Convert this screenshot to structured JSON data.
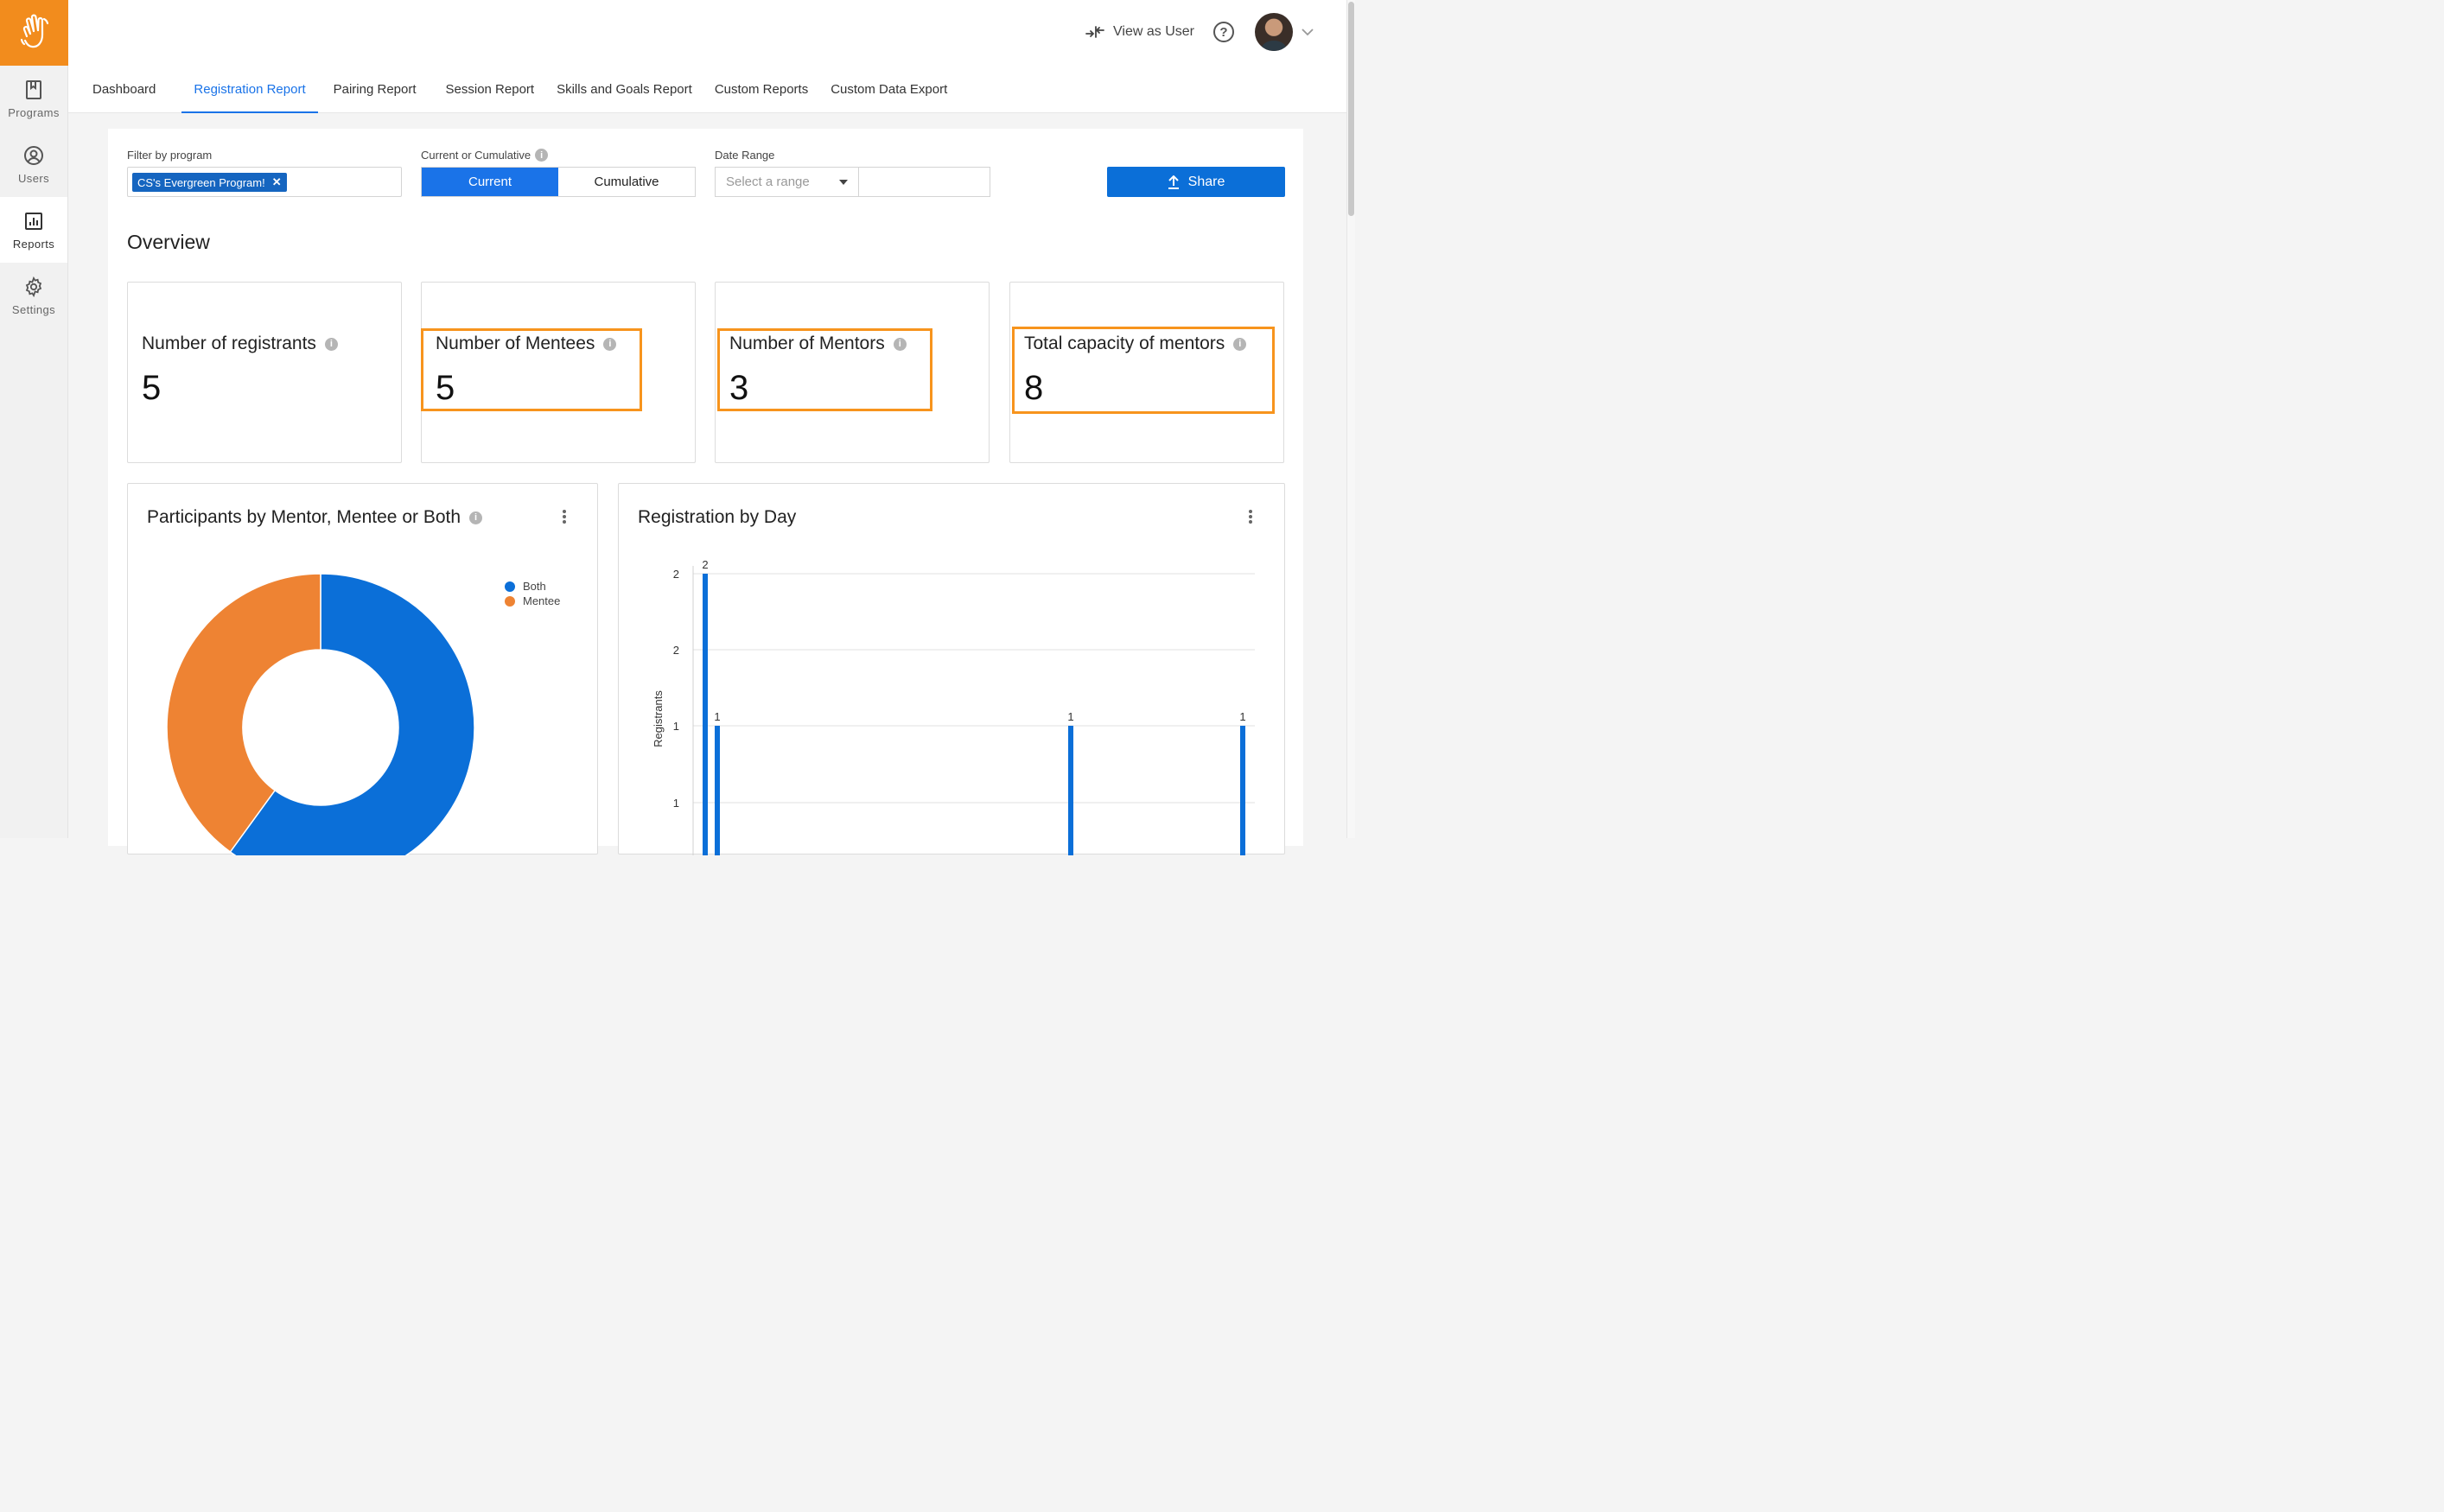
{
  "colors": {
    "accent": "#1a73e8",
    "brand_orange": "#f28c1d",
    "series_both": "#0b6fd8",
    "series_mentee": "#ee8333",
    "highlight": "#f7941d"
  },
  "sidebar": {
    "logo_icon": "waving-hand-icon",
    "items": [
      {
        "label": "Programs",
        "icon": "bookmark-icon",
        "active": false
      },
      {
        "label": "Users",
        "icon": "user-circle-icon",
        "active": false
      },
      {
        "label": "Reports",
        "icon": "bar-chart-icon",
        "active": true
      },
      {
        "label": "Settings",
        "icon": "gear-icon",
        "active": false
      }
    ]
  },
  "header": {
    "view_as_user": "View as User",
    "help_icon": "question-icon",
    "tabs": [
      {
        "label": "Dashboard",
        "active": false
      },
      {
        "label": "Registration Report",
        "active": true
      },
      {
        "label": "Pairing Report",
        "active": false
      },
      {
        "label": "Session Report",
        "active": false
      },
      {
        "label": "Skills and Goals Report",
        "active": false
      },
      {
        "label": "Custom Reports",
        "active": false
      },
      {
        "label": "Custom Data Export",
        "active": false
      }
    ]
  },
  "filters": {
    "program_label": "Filter by program",
    "program_chip": "CS's Evergreen Program!",
    "mode_label": "Current or Cumulative",
    "mode_options": [
      "Current",
      "Cumulative"
    ],
    "mode_selected": "Current",
    "date_label": "Date Range",
    "date_placeholder": "Select a range",
    "share_label": "Share"
  },
  "overview": {
    "title": "Overview",
    "stats": [
      {
        "label": "Number of registrants",
        "value": "5",
        "highlighted": false
      },
      {
        "label": "Number of Mentees",
        "value": "5",
        "highlighted": true
      },
      {
        "label": "Number of Mentors",
        "value": "3",
        "highlighted": true
      },
      {
        "label": "Total capacity of mentors",
        "value": "8",
        "highlighted": true
      }
    ]
  },
  "panels": {
    "participants_title": "Participants by Mentor, Mentee or Both",
    "registration_title": "Registration by Day"
  },
  "chart_data": [
    {
      "type": "pie",
      "donut": true,
      "title": "Participants by Mentor, Mentee or Both",
      "categories": [
        "Both",
        "Mentee"
      ],
      "values": [
        3,
        2
      ],
      "legend_placement": "top-right"
    },
    {
      "type": "bar",
      "title": "Registration by Day",
      "ylabel": "Registrants",
      "ytick_labels": [
        "2",
        "2",
        "1",
        "1"
      ],
      "grid": true,
      "values": [
        2,
        1,
        1,
        1
      ],
      "data_labels": [
        "2",
        "1",
        "1",
        "1"
      ],
      "ylim": [
        0,
        2
      ]
    }
  ]
}
